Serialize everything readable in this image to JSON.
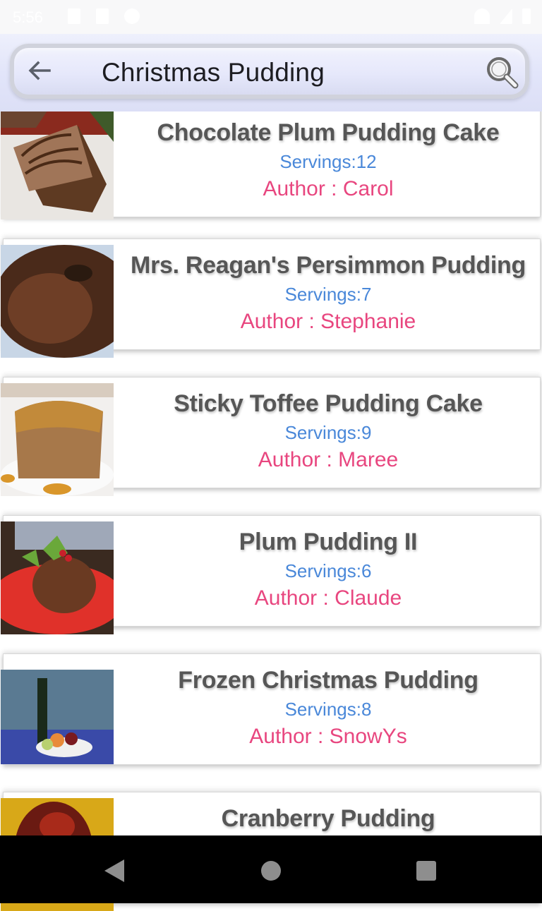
{
  "status_bar": {
    "time": "5:56"
  },
  "search": {
    "query": "Christmas Pudding",
    "back_icon": "arrow-left-icon",
    "search_icon": "magnifier-icon"
  },
  "colors": {
    "title": "#565656",
    "servings": "#4a88d9",
    "author": "#e8467f",
    "nav_bar": "#000000"
  },
  "recipes": [
    {
      "title": "Chocolate Plum Pudding Cake",
      "servings": "Servings:12",
      "author": "Author : Carol",
      "thumbnail": "chocolate-cake-slice"
    },
    {
      "title": "Mrs. Reagan's Persimmon Pudding",
      "servings": "Servings:7",
      "author": "Author : Stephanie",
      "thumbnail": "bundt-pudding"
    },
    {
      "title": "Sticky Toffee Pudding Cake",
      "servings": "Servings:9",
      "author": "Author : Maree",
      "thumbnail": "toffee-pudding"
    },
    {
      "title": "Plum Pudding II",
      "servings": "Servings:6",
      "author": "Author : Claude",
      "thumbnail": "plum-pudding-holly"
    },
    {
      "title": "Frozen Christmas Pudding",
      "servings": "Servings:8",
      "author": "Author : SnowYs",
      "thumbnail": "picnic-by-sea"
    },
    {
      "title": "Cranberry Pudding",
      "servings": "",
      "author": "",
      "thumbnail": "cranberry-pudding"
    }
  ],
  "nav": {
    "back": "nav-back-icon",
    "home": "nav-home-icon",
    "recents": "nav-recents-icon"
  }
}
